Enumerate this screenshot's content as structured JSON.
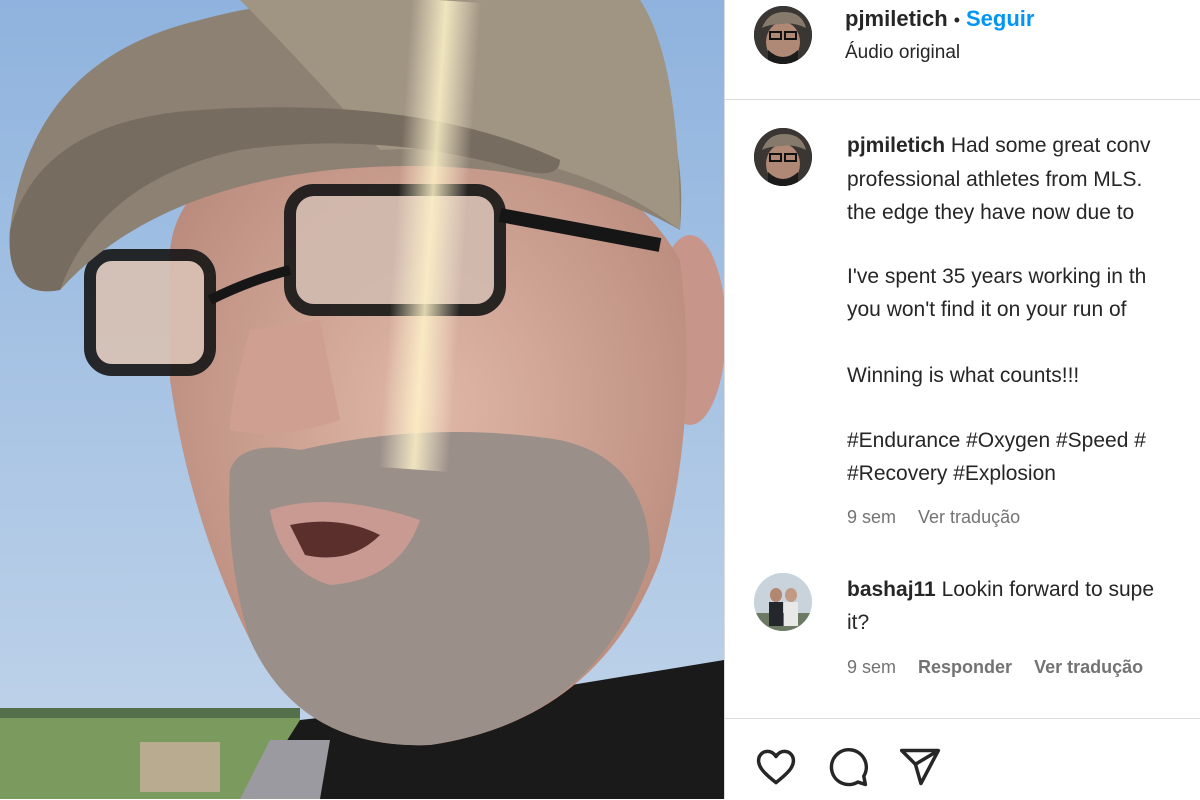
{
  "header": {
    "username": "pjmiletich",
    "separator": "•",
    "follow_label": "Seguir",
    "audio_label": "Áudio original"
  },
  "caption": {
    "username": "pjmiletich",
    "line1": "Had some great conv",
    "line2": "professional athletes from MLS.",
    "line3": "the edge they have now due to",
    "line4": "I've spent 35 years working in th",
    "line5": "you won't find it on your run of",
    "line6": "Winning is what counts!!!",
    "line7": "#Endurance #Oxygen #Speed #",
    "line8": "#Recovery #Explosion",
    "time": "9 sem",
    "translate_label": "Ver tradução"
  },
  "comment": {
    "username": "bashaj11",
    "line1": "Lookin forward to supe",
    "line2": "it?",
    "time": "9 sem",
    "reply_label": "Responder",
    "translate_label": "Ver tradução"
  },
  "actions": {
    "icons": [
      "heart-icon",
      "comment-icon",
      "share-icon"
    ]
  }
}
